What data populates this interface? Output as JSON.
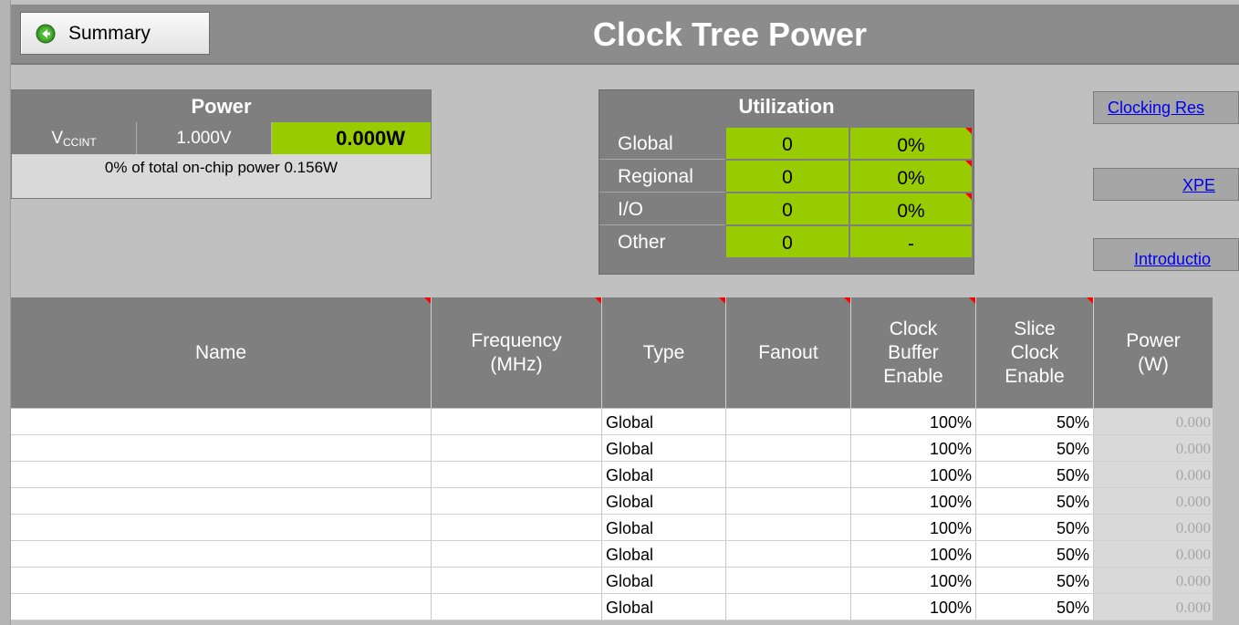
{
  "header": {
    "back_button_label": "Summary",
    "title": "Clock Tree Power"
  },
  "power": {
    "heading": "Power",
    "rail_main": "V",
    "rail_sub": "CCINT",
    "voltage": "1.000V",
    "watts": "0.000W",
    "note": "0% of total on-chip power 0.156W"
  },
  "utilization": {
    "heading": "Utilization",
    "rows": [
      {
        "name": "Global",
        "count": "0",
        "pct": "0%"
      },
      {
        "name": "Regional",
        "count": "0",
        "pct": "0%"
      },
      {
        "name": "I/O",
        "count": "0",
        "pct": "0%"
      },
      {
        "name": "Other",
        "count": "0",
        "pct": "-"
      }
    ]
  },
  "links": {
    "clocking": "Clocking Res",
    "xpe": "XPE",
    "intro": "Introductio"
  },
  "table": {
    "columns": [
      {
        "line1": "Name",
        "line2": "",
        "line3": "",
        "line4": ""
      },
      {
        "line1": "Frequency",
        "line2": "(MHz)",
        "line3": "",
        "line4": ""
      },
      {
        "line1": "Type",
        "line2": "",
        "line3": "",
        "line4": ""
      },
      {
        "line1": "Fanout",
        "line2": "",
        "line3": "",
        "line4": ""
      },
      {
        "line1": "Clock",
        "line2": "Buffer",
        "line3": "Enable",
        "line4": ""
      },
      {
        "line1": "Slice",
        "line2": "Clock",
        "line3": "Enable",
        "line4": ""
      },
      {
        "line1": "Power",
        "line2": "(W)",
        "line3": "",
        "line4": ""
      }
    ],
    "rows": [
      {
        "name": "",
        "freq": "",
        "type": "Global",
        "fanout": "",
        "cbe": "100%",
        "sce": "50%",
        "power": "0.000"
      },
      {
        "name": "",
        "freq": "",
        "type": "Global",
        "fanout": "",
        "cbe": "100%",
        "sce": "50%",
        "power": "0.000"
      },
      {
        "name": "",
        "freq": "",
        "type": "Global",
        "fanout": "",
        "cbe": "100%",
        "sce": "50%",
        "power": "0.000"
      },
      {
        "name": "",
        "freq": "",
        "type": "Global",
        "fanout": "",
        "cbe": "100%",
        "sce": "50%",
        "power": "0.000"
      },
      {
        "name": "",
        "freq": "",
        "type": "Global",
        "fanout": "",
        "cbe": "100%",
        "sce": "50%",
        "power": "0.000"
      },
      {
        "name": "",
        "freq": "",
        "type": "Global",
        "fanout": "",
        "cbe": "100%",
        "sce": "50%",
        "power": "0.000"
      },
      {
        "name": "",
        "freq": "",
        "type": "Global",
        "fanout": "",
        "cbe": "100%",
        "sce": "50%",
        "power": "0.000"
      },
      {
        "name": "",
        "freq": "",
        "type": "Global",
        "fanout": "",
        "cbe": "100%",
        "sce": "50%",
        "power": "0.000"
      }
    ]
  },
  "colors": {
    "accent_green": "#99cc00",
    "header_gray": "#7f7f7f",
    "comment_marker": "#ff0000"
  }
}
